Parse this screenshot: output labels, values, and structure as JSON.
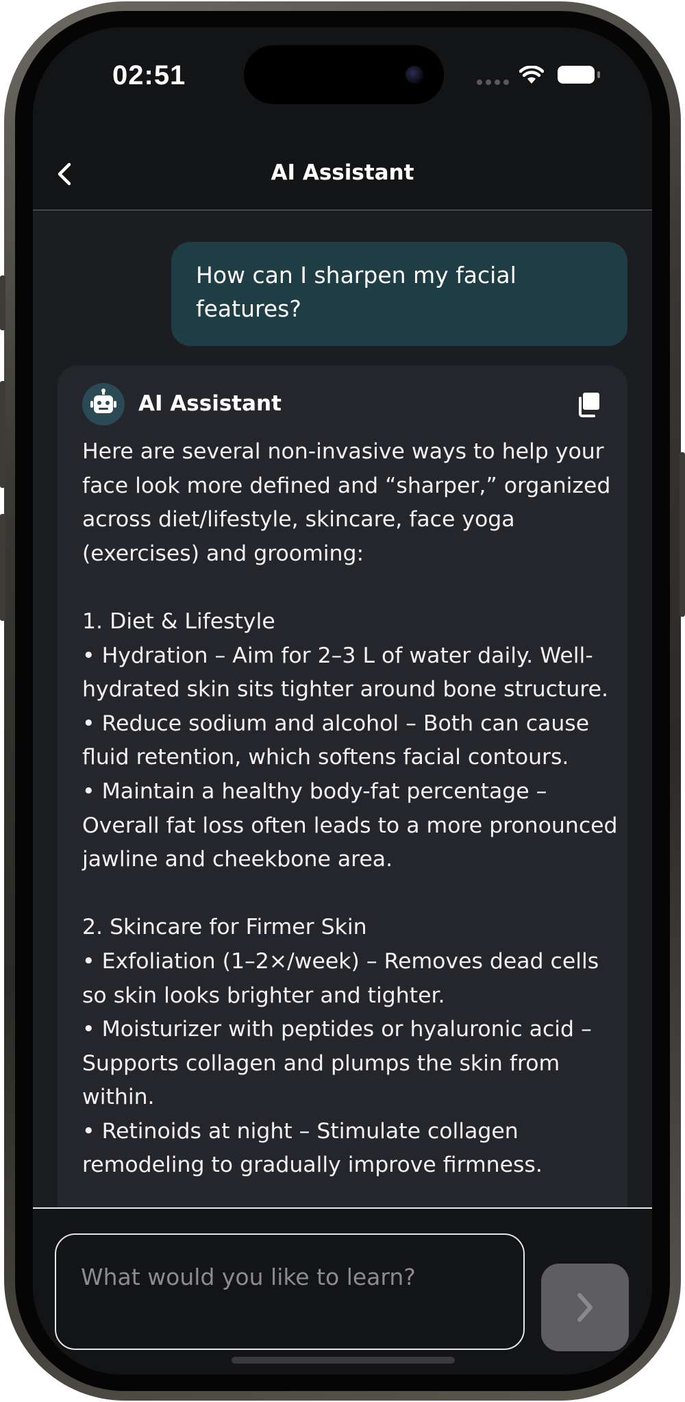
{
  "status_bar": {
    "time": "02:51"
  },
  "nav": {
    "title": "AI Assistant"
  },
  "chat": {
    "user_message": "How can I sharpen my facial features?",
    "assistant_name": "AI Assistant",
    "assistant_message": "Here are several non-invasive ways to help your face look more defined and “sharper,” organized across diet/lifestyle, skincare, face yoga (exercises) and grooming:\n\n1. Diet & Lifestyle\n• Hydration – Aim for 2–3 L of water daily. Well-hydrated skin sits tighter around bone structure.\n• Reduce sodium and alcohol – Both can cause fluid retention, which softens facial contours.\n• Maintain a healthy body-fat percentage – Overall fat loss often leads to a more pronounced jawline and cheekbone area.\n\n2. Skincare for Firmer Skin\n• Exfoliation (1–2×/week) – Removes dead cells so skin looks brighter and tighter.\n• Moisturizer with peptides or hyaluronic acid – Supports collagen and plumps the skin from within.\n• Retinoids at night – Stimulate collagen remodeling to gradually improve firmness."
  },
  "composer": {
    "placeholder": "What would you like to learn?"
  },
  "colors": {
    "user_bubble": "#1f3d45",
    "assistant_card": "#25262b",
    "background": "#1c1d21",
    "send_button_disabled": "#5e5e62"
  }
}
